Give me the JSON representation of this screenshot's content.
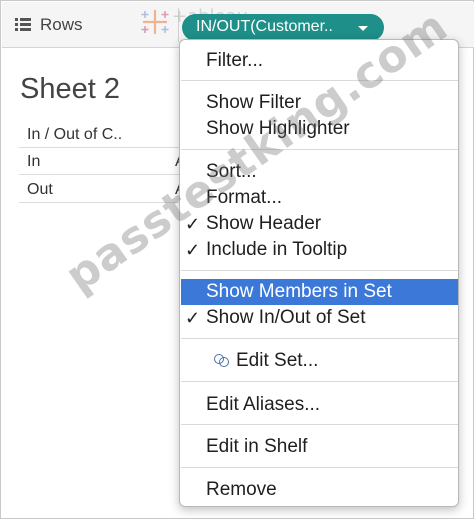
{
  "shelf": {
    "label": "Rows",
    "pill_label": "IN/OUT(Customer..",
    "logo_text": "+ableau"
  },
  "sheet": {
    "title": "Sheet 2",
    "column_header": "In / Out of C..",
    "rows": [
      "In",
      "Out"
    ],
    "clipped_cell": "A"
  },
  "menu": {
    "items": [
      {
        "label": "Filter...",
        "checked": false
      },
      {
        "label": "Show Filter",
        "checked": false
      },
      {
        "label": "Show Highlighter",
        "checked": false
      },
      {
        "label": "Sort...",
        "checked": false
      },
      {
        "label": "Format...",
        "checked": false
      },
      {
        "label": "Show Header",
        "checked": true
      },
      {
        "label": "Include in Tooltip",
        "checked": true
      },
      {
        "label": "Show Members in Set",
        "checked": false,
        "highlighted": true
      },
      {
        "label": "Show In/Out of Set",
        "checked": true
      },
      {
        "label": "Edit Set...",
        "icon": "set-icon"
      },
      {
        "label": "Edit Aliases...",
        "checked": false
      },
      {
        "label": "Edit in Shelf",
        "checked": false
      },
      {
        "label": "Remove",
        "checked": false
      }
    ],
    "check_glyph": "✓"
  },
  "watermark": "passtestking.com",
  "colors": {
    "pill": "#1e8f89",
    "highlight": "#3c78d8"
  }
}
